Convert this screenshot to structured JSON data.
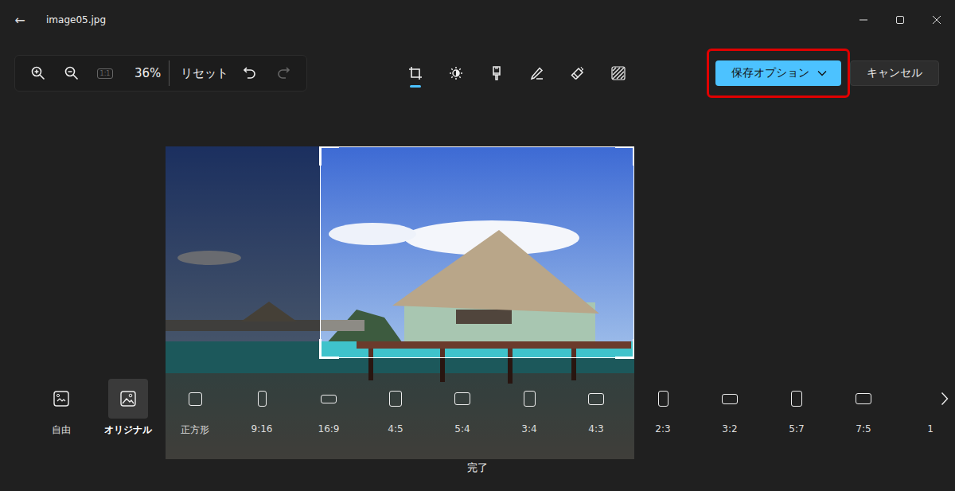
{
  "window": {
    "title": "image05.jpg",
    "back": "←"
  },
  "zoom": {
    "actual_size": {
      "label": "1:1",
      "disabled": true
    },
    "level": "36%",
    "reset": "リセット",
    "undo_disabled": false,
    "redo_disabled": true
  },
  "tools": [
    {
      "kind": "crop",
      "selected": true
    },
    {
      "kind": "adjust",
      "selected": false
    },
    {
      "kind": "filter",
      "selected": false
    },
    {
      "kind": "markup",
      "selected": false
    },
    {
      "kind": "erase",
      "selected": false
    },
    {
      "kind": "background",
      "selected": false
    }
  ],
  "actions": {
    "save": {
      "label": "保存オプション",
      "highlighted": true
    },
    "cancel": "キャンセル"
  },
  "aspect_ratios": [
    {
      "label": "自由",
      "kind": "free",
      "selected": false
    },
    {
      "label": "オリジナル",
      "kind": "original",
      "selected": true
    },
    {
      "label": "正方形",
      "kind": "square",
      "selected": false
    },
    {
      "label": "9:16",
      "kind": "ratio",
      "selected": false
    },
    {
      "label": "16:9",
      "kind": "ratio",
      "selected": false
    },
    {
      "label": "4:5",
      "kind": "ratio",
      "selected": false
    },
    {
      "label": "5:4",
      "kind": "ratio",
      "selected": false
    },
    {
      "label": "3:4",
      "kind": "ratio",
      "selected": false
    },
    {
      "label": "4:3",
      "kind": "ratio",
      "selected": false
    },
    {
      "label": "2:3",
      "kind": "ratio",
      "selected": false
    },
    {
      "label": "3:2",
      "kind": "ratio",
      "selected": false
    },
    {
      "label": "5:7",
      "kind": "ratio",
      "selected": false
    },
    {
      "label": "7:5",
      "kind": "ratio",
      "selected": false
    },
    {
      "label": "1",
      "kind": "cut",
      "selected": false
    }
  ],
  "done": "完了"
}
